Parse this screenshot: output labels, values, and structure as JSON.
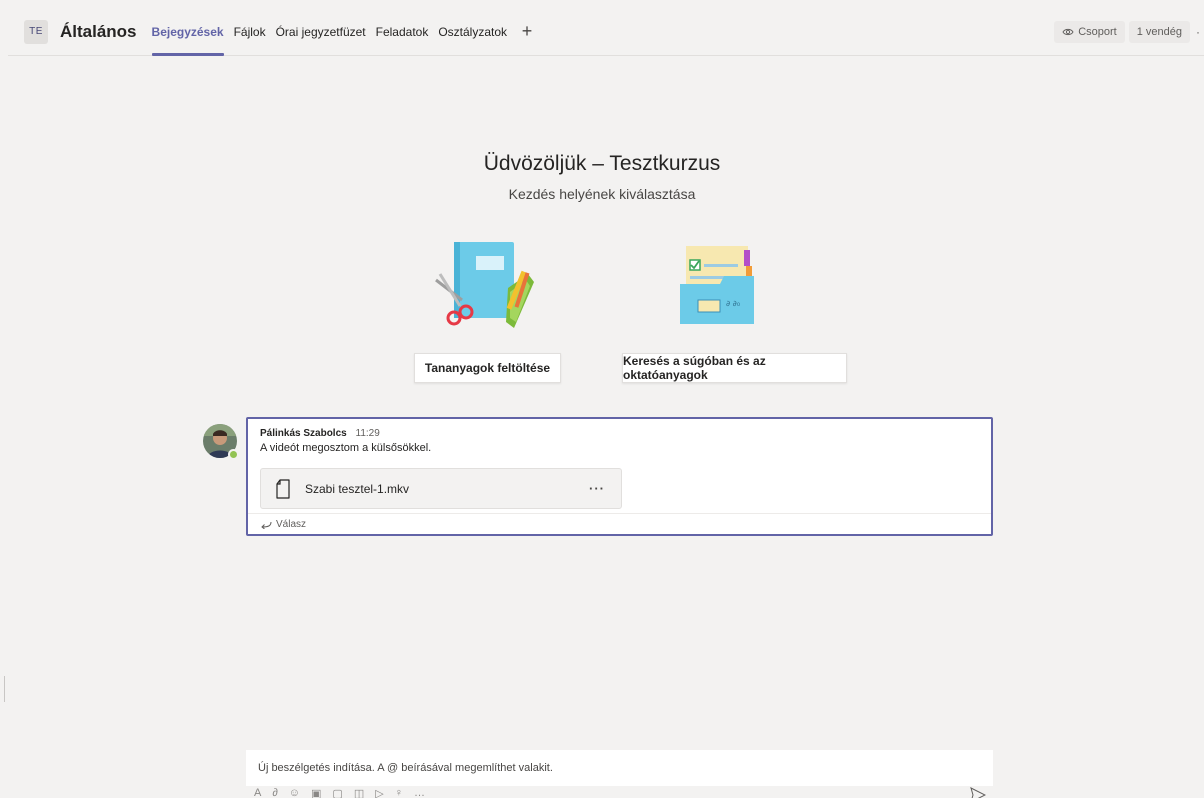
{
  "header": {
    "team_initials": "TE",
    "channel_name": "Általános",
    "tabs": [
      {
        "label": "Bejegyzések",
        "active": true
      },
      {
        "label": "Fájlok",
        "active": false
      },
      {
        "label": "Órai jegyzetfüzet",
        "active": false
      },
      {
        "label": "Feladatok",
        "active": false
      },
      {
        "label": "Osztályzatok",
        "active": false
      }
    ],
    "add_tab_symbol": "+",
    "group_label": "Csoport",
    "guest_label": "1 vendég",
    "more_symbol": "·"
  },
  "welcome": {
    "title": "Üdvözöljük – Tesztkurzus",
    "subtitle": "Kezdés helyének kiválasztása",
    "upload_button": "Tananyagok feltöltése",
    "help_button": "Keresés a súgóban és az oktatóanyagok"
  },
  "message": {
    "author": "Pálinkás Szabolcs",
    "time": "11:29",
    "text": "A videót megosztom a külsősökkel.",
    "file_name": "Szabi tesztel-1.mkv",
    "file_more": "···",
    "reply_label": "Válasz"
  },
  "compose": {
    "placeholder": "Új beszélgetés indítása. A @ beírásával megemlíthet valakit."
  },
  "colors": {
    "accent": "#6264a7",
    "presence": "#92c353",
    "background": "#f3f2f1"
  },
  "icons": [
    "eye-icon",
    "plus-icon",
    "file-icon",
    "reply-icon",
    "send-icon",
    "presence-available-icon"
  ]
}
